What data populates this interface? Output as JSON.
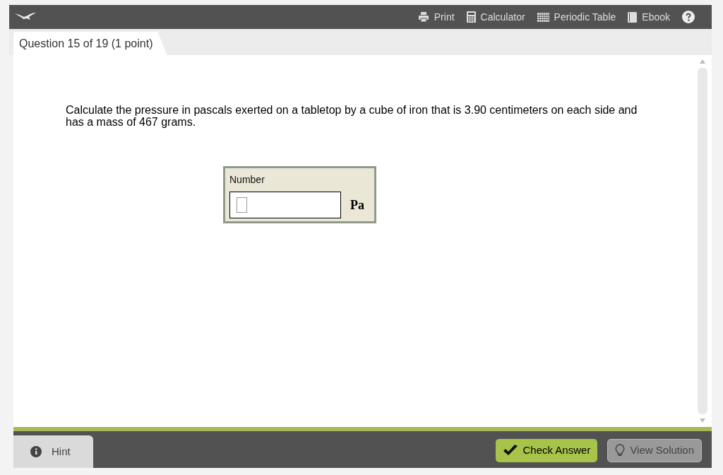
{
  "toolbar": {
    "items": [
      {
        "kind": "print",
        "label": "Print"
      },
      {
        "kind": "calculator",
        "label": "Calculator"
      },
      {
        "kind": "table",
        "label": "Periodic Table"
      },
      {
        "kind": "book",
        "label": "Ebook"
      }
    ]
  },
  "question_tab": {
    "label": "Question 15 of 19 (1 point)"
  },
  "question": {
    "text": "Calculate the pressure in pascals exerted on a tabletop by a cube of iron that is 3.90 centimeters on each side and has a mass of 467 grams."
  },
  "answer": {
    "label": "Number",
    "unit": "Pa"
  },
  "footer": {
    "hint": "Hint",
    "buttons": [
      {
        "label": "Check Answer",
        "disabled": false,
        "kind": "check"
      },
      {
        "label": "View Solution",
        "disabled": true,
        "kind": "solution"
      }
    ]
  }
}
